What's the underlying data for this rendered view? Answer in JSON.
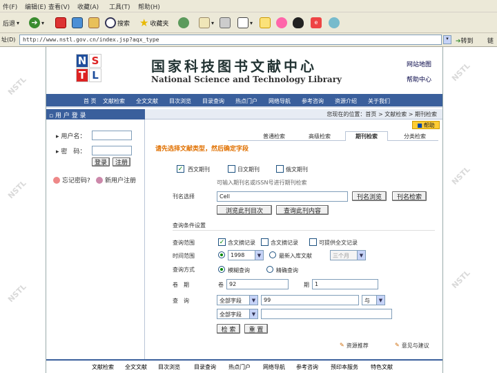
{
  "menu": [
    "件(F)",
    "编辑(E)",
    "查看(V)",
    "收藏(A)",
    "工具(T)",
    "帮助(H)"
  ],
  "toolbar": {
    "back": "后退",
    "search": "搜索",
    "favorites": "收藏夹"
  },
  "address": {
    "label": "址(D)",
    "value": "http://www.nstl.gov.cn/index.jsp?aqx_type",
    "go": "转到",
    "links": "链"
  },
  "header": {
    "logo": [
      "N",
      "S",
      "T",
      "L"
    ],
    "cn_title": "国家科技图书文献中心",
    "en_title": "National Science and Technology Library",
    "link1": "网站地图",
    "link2": "帮助中心"
  },
  "nav": [
    "首 页",
    "文献检索",
    "全文文献",
    "目次浏览",
    "目录查询",
    "热点门户",
    "网络导航",
    "参考咨询",
    "资源介绍",
    "关于我们"
  ],
  "crumb": "您现在的位置：首页 > 文献检索 > 期刊检索",
  "sidebar": {
    "title": "用 户 登 录",
    "user_label": "用户名：",
    "pwd_label": "密　码：",
    "login": "登录",
    "reset": "注册",
    "forgot": "忘记密码?",
    "new_user": "新用户注册"
  },
  "tabs": [
    "普通检索",
    "高级检索",
    "期刊检索",
    "分类检索"
  ],
  "help": "帮助",
  "prompt": "请先选择文献类型，然后确定字段",
  "doc_types": [
    "西文期刊",
    "日文期刊",
    "俄文期刊"
  ],
  "hint": "可输入期刊名或ISSN号进行期刊检索",
  "journal": {
    "label": "刊名选择",
    "value": "Cell",
    "btn_browse": "刊名浏览",
    "btn_search": "刊名检索",
    "btn_catalog": "浏览此刊目次",
    "btn_query": "查询此刊内容"
  },
  "conditions": {
    "title": "查询条件设置",
    "scope_label": "查询范围",
    "scope_opts": [
      "含文摘记录",
      "含文摘记录",
      "可提供全文记录"
    ],
    "time_label": "时间范围",
    "year": "1998",
    "time_opt": "最新入库文献",
    "period": "三个月",
    "mode_label": "查询方式",
    "mode_opts": [
      "模糊查询",
      "精确查询"
    ],
    "vol_label": "卷　期",
    "vol_prefix": "卷",
    "vol_value": "92",
    "issue_label": "期",
    "issue_value": "1",
    "query_label": "查　询",
    "field1": "全部字段",
    "value1": "99",
    "op": "与",
    "field2": "全部字段",
    "value2": ""
  },
  "search_btn": "检 索",
  "reset_btn": "重 置",
  "bottom": {
    "recommend": "资源推荐",
    "feedback": "意见与建议"
  },
  "footer": [
    "文献检索",
    "全文文献",
    "目次浏览",
    "目录查询",
    "热点门户",
    "网络导航",
    "参考咨询",
    "预印本服务",
    "特色文献"
  ],
  "watermark": "NSTL"
}
